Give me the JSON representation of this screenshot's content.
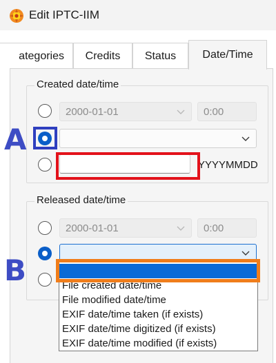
{
  "window": {
    "title": "Edit IPTC-IIM",
    "icon": "xnview-app-icon"
  },
  "tabs": [
    {
      "label": "ategories",
      "active": false
    },
    {
      "label": "Credits",
      "active": false
    },
    {
      "label": "Status",
      "active": false
    },
    {
      "label": "Date/Time",
      "active": true
    }
  ],
  "created_group": {
    "title": "Created date/time",
    "date_value": "2000-01-01",
    "time_value": "0:00",
    "preset_value": "",
    "text_value": "",
    "format_label": "YYYYMMDD",
    "selected_option": 2
  },
  "released_group": {
    "title": "Released date/time",
    "date_value": "2000-01-01",
    "time_value": "0:00",
    "preset_value": "",
    "selected_option": 2
  },
  "dropdown_options": [
    "",
    "File created date/time",
    "File modified date/time",
    "EXIF date/time taken (if exists)",
    "EXIF date/time digitized (if exists)",
    "EXIF date/time modified (if exists)"
  ],
  "annotations": {
    "a_label": "A",
    "b_label": "B",
    "colors": {
      "a_box": "#2f3fbf",
      "red_box": "#e3121b",
      "orange_box": "#f07d1a",
      "a_letter": "#3d4cc4",
      "b_letter": "#3d4cc4"
    }
  },
  "colors": {
    "accent": "#0a5ec8",
    "selection": "#0a6ad6",
    "panel_bg": "#f5f5f5"
  }
}
